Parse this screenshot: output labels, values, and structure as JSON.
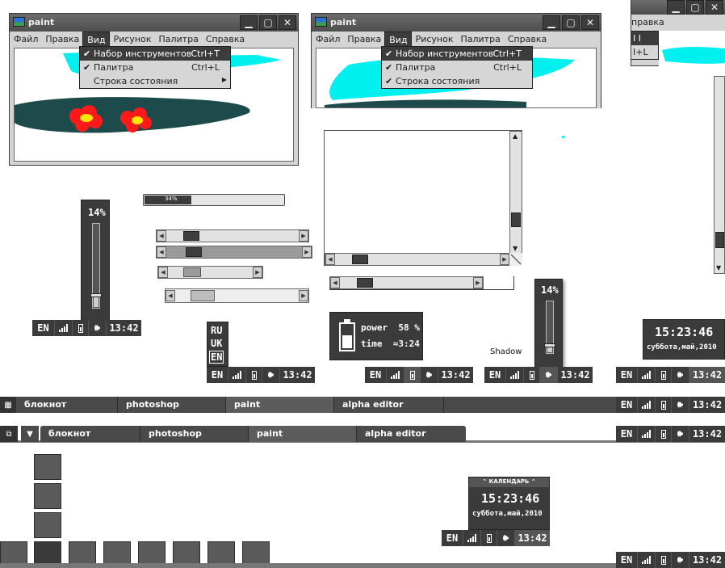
{
  "window": {
    "title": "paint"
  },
  "menu": [
    "Файл",
    "Правка",
    "Вид",
    "Рисунок",
    "Палитра",
    "Справка"
  ],
  "menu_right": [
    "правка"
  ],
  "view_menu": [
    {
      "label": "Набор инструментов",
      "shortcut": "Ctrl+T",
      "checked": true
    },
    {
      "label": "Палитра",
      "shortcut": "Ctrl+L",
      "checked": true
    },
    {
      "label": "Строка состояния",
      "shortcut": "",
      "checked": false
    }
  ],
  "view_menu2": [
    {
      "label": "Набор инструментов",
      "shortcut": "Ctrl+T",
      "checked": true
    },
    {
      "label": "Палитра",
      "shortcut": "Ctrl+L",
      "checked": true
    },
    {
      "label": "Строка состояния",
      "shortcut": "",
      "checked": true
    }
  ],
  "partial_menu": {
    "item1": "I I",
    "item2": "I+L"
  },
  "progress": {
    "label": "34%",
    "value": 34
  },
  "volume": {
    "label": "14%",
    "value": 14
  },
  "tray": {
    "lang": "EN",
    "time": "13:42"
  },
  "languages": [
    "RU",
    "UK",
    "EN"
  ],
  "power": {
    "line1": "power  58 %",
    "line2": "time  ≈3:24",
    "value": 58
  },
  "shadow_label": "Shadow",
  "clock": {
    "time": "15:23:46",
    "date": "суббота,май,2010"
  },
  "calendar": {
    "header": "КАЛЕНДАРЬ",
    "time": "15:23:46",
    "date": "суббота,май,2010"
  },
  "tasks": [
    "блокнот",
    "photoshop",
    "paint",
    "alpha editor"
  ],
  "colors": {
    "titlebar": "#5a5a5a",
    "dark": "#3b3b3b",
    "cyan": "#00f0f0",
    "pond": "#1d4a4a",
    "flower": "#ff1a1a",
    "flowerCenter": "#ffe600"
  }
}
